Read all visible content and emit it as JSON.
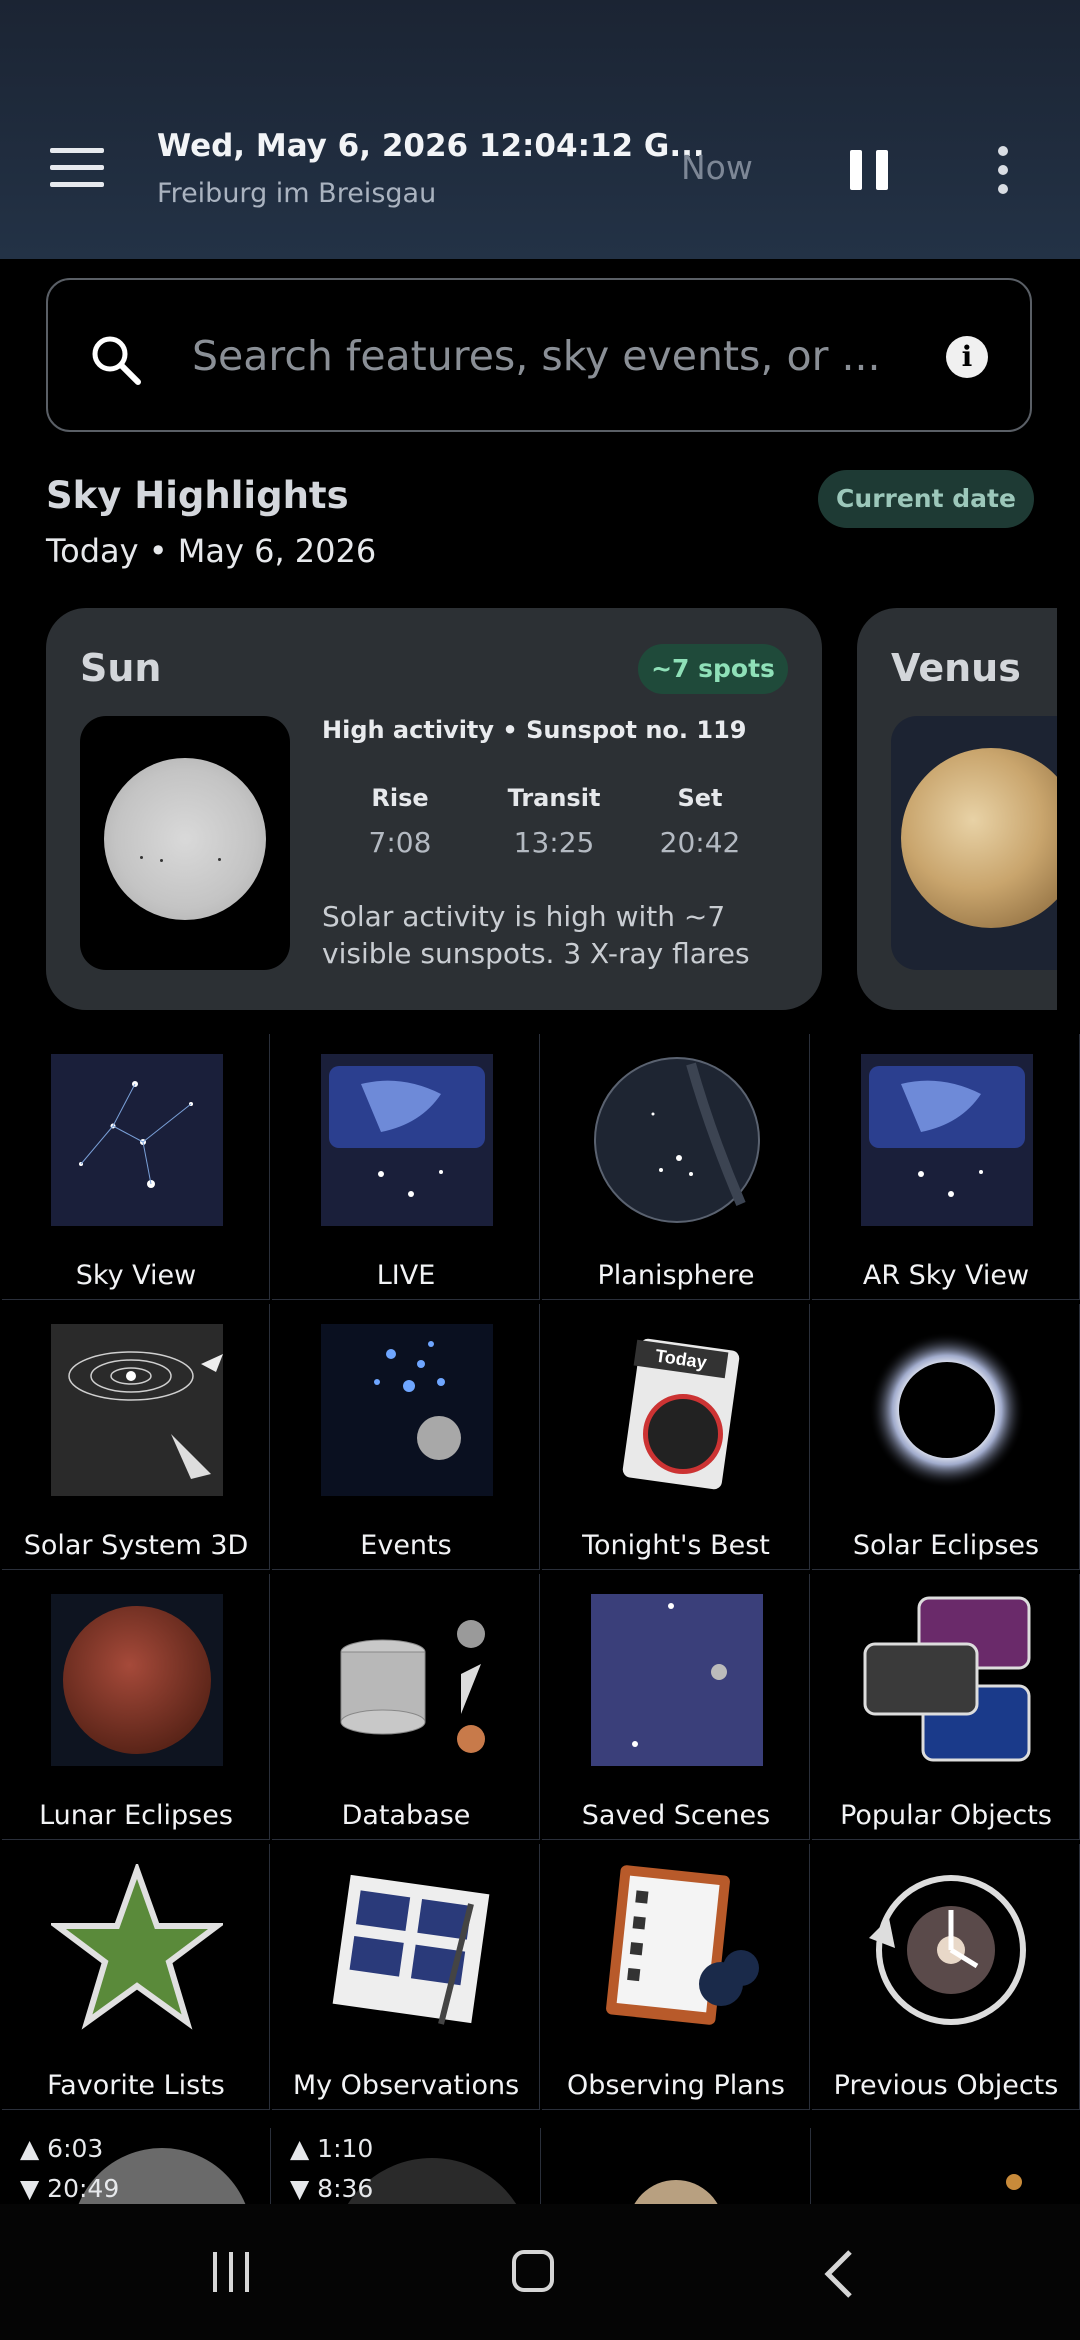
{
  "header": {
    "title": "Wed, May 6, 2026 12:04:12 G...",
    "subtitle": "Freiburg im Breisgau",
    "now_label": "Now"
  },
  "search": {
    "placeholder": "Search features, sky events, or ..."
  },
  "highlights": {
    "title": "Sky Highlights",
    "date": "Today • May 6, 2026",
    "chip": "Current date"
  },
  "sun_card": {
    "name": "Sun",
    "badge": "~7 spots",
    "activity": "High activity • Sunspot no. 119",
    "rise_label": "Rise",
    "rise": "7:08",
    "transit_label": "Transit",
    "transit": "13:25",
    "set_label": "Set",
    "set": "20:42",
    "description": "Solar activity is high with ~7 visible sunspots. 3 X-ray flares"
  },
  "venus_card": {
    "name": "Venus"
  },
  "tiles": [
    {
      "label": "Sky View",
      "icon": "sky-view-icon"
    },
    {
      "label": "LIVE",
      "icon": "live-icon"
    },
    {
      "label": "Planisphere",
      "icon": "planisphere-icon"
    },
    {
      "label": "AR Sky View",
      "icon": "ar-sky-view-icon"
    },
    {
      "label": "Solar System 3D",
      "icon": "solar-system-icon"
    },
    {
      "label": "Events",
      "icon": "events-icon"
    },
    {
      "label": "Tonight's Best",
      "icon": "tonights-best-icon"
    },
    {
      "label": "Solar Eclipses",
      "icon": "solar-eclipse-icon"
    },
    {
      "label": "Lunar Eclipses",
      "icon": "lunar-eclipse-icon"
    },
    {
      "label": "Database",
      "icon": "database-icon"
    },
    {
      "label": "Saved Scenes",
      "icon": "saved-scenes-icon"
    },
    {
      "label": "Popular Objects",
      "icon": "popular-objects-icon"
    },
    {
      "label": "Favorite Lists",
      "icon": "favorite-star-icon"
    },
    {
      "label": "My Observations",
      "icon": "observations-notebook-icon"
    },
    {
      "label": "Observing Plans",
      "icon": "observing-plans-icon"
    },
    {
      "label": "Previous Objects",
      "icon": "previous-objects-icon"
    }
  ],
  "today_tile_text": "Today",
  "partial_row": [
    {
      "rise": "▲ 6:03",
      "set": "▼ 20:49"
    },
    {
      "rise": "▲ 1:10",
      "set": "▼ 8:36"
    }
  ]
}
